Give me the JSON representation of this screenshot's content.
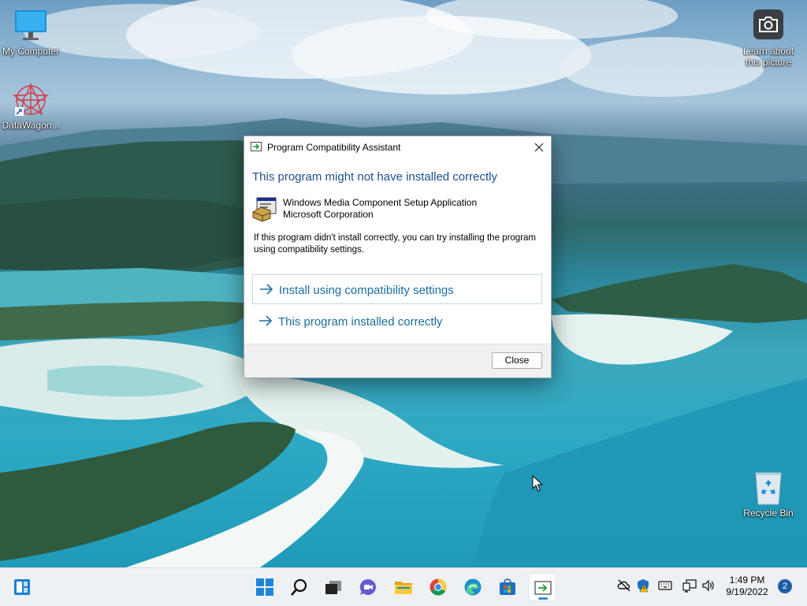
{
  "desktop": {
    "icons": [
      {
        "label": "My Computer"
      },
      {
        "label": "DataWagon..."
      },
      {
        "label": "Learn about\nthis picture"
      },
      {
        "label": "Recycle Bin"
      }
    ]
  },
  "dialog": {
    "title": "Program Compatibility Assistant",
    "heading": "This program might not have installed correctly",
    "program_name": "Windows Media Component Setup Application",
    "program_vendor": "Microsoft Corporation",
    "description": "If this program didn't install correctly, you can try installing the program using compatibility settings.",
    "options": [
      {
        "label": "Install using compatibility settings"
      },
      {
        "label": "This program installed correctly"
      }
    ],
    "close_button": "Close"
  },
  "taskbar": {
    "time": "1:49 PM",
    "date": "9/19/2022",
    "notification_count": "2",
    "apps": [
      "start-icon",
      "search-icon",
      "task-view-icon",
      "chat-icon",
      "file-explorer-icon",
      "chrome-icon",
      "edge-icon",
      "store-icon",
      "compatibility-assistant-icon"
    ]
  },
  "colors": {
    "heading": "#1f4e8c",
    "command_link": "#1a6e9e",
    "taskbar": "#eef1f4",
    "badge": "#1f5fa8"
  }
}
